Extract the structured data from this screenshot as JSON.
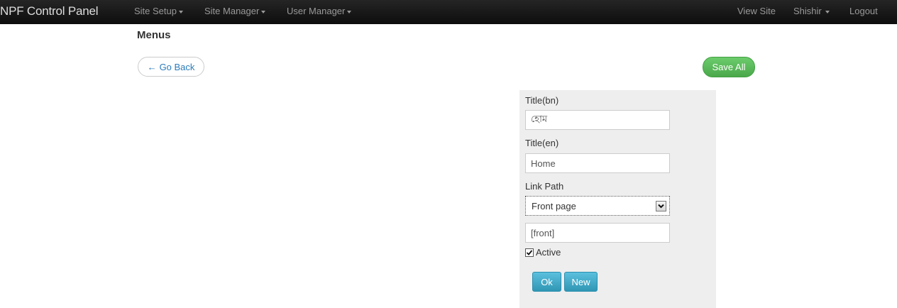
{
  "navbar": {
    "brand": "NPF Control Panel",
    "menus": [
      "Site Setup",
      "Site Manager",
      "User Manager"
    ],
    "right": {
      "view_site": "View Site",
      "user": "Shishir",
      "logout": "Logout"
    }
  },
  "page": {
    "title": "Menus",
    "back_label": "Go Back",
    "back_arrow": "←",
    "save_all_label": "Save All"
  },
  "form": {
    "title_bn_label": "Title(bn)",
    "title_bn_value": "হোম",
    "title_en_label": "Title(en)",
    "title_en_value": "Home",
    "link_path_label": "Link Path",
    "link_path_selected": "Front page",
    "path_value": "[front]",
    "active_label": "Active",
    "active_checked": true,
    "ok_label": "Ok",
    "new_label": "New"
  },
  "colors": {
    "navbar": "#1b1b1b",
    "save_button": "#5cb85c",
    "info_button": "#49afcd",
    "panel_bg": "#eeeeee",
    "link": "#2a7bbb"
  }
}
